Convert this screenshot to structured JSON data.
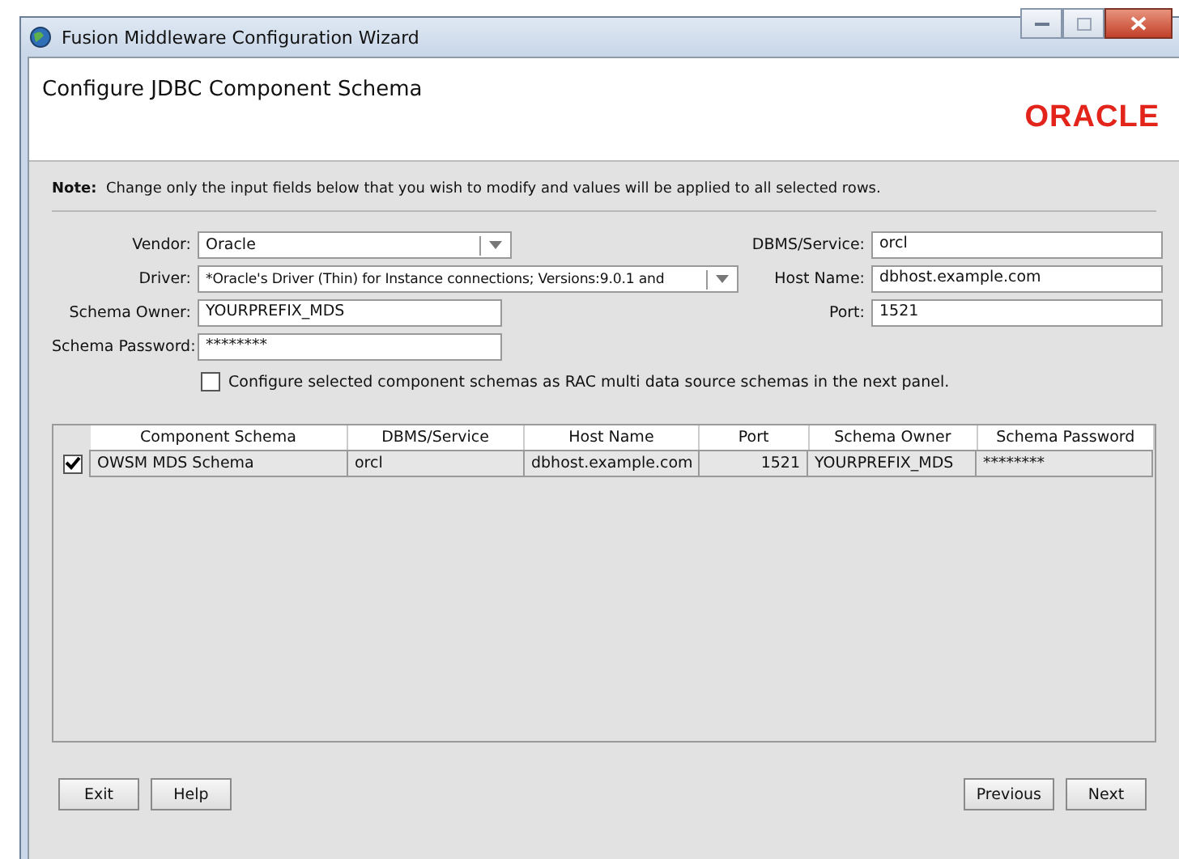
{
  "window": {
    "title": "Fusion Middleware Configuration Wizard"
  },
  "header": {
    "title": "Configure JDBC Component Schema",
    "logo": "ORACLE"
  },
  "note": {
    "label": "Note:",
    "text": "Change only the input fields below that you wish to modify and values will be applied to all selected rows."
  },
  "left_fields": [
    {
      "label": "Vendor:",
      "value": "Oracle",
      "kind": "combo"
    },
    {
      "label": "Driver:",
      "value": "*Oracle's  Driver (Thin) for Instance connections; Versions:9.0.1 and",
      "kind": "long_combo"
    },
    {
      "label": "Schema Owner:",
      "value": "YOURPREFIX_MDS",
      "kind": "text"
    },
    {
      "label": "Schema Password:",
      "value": "********",
      "kind": "text"
    }
  ],
  "right_fields": [
    {
      "label": "DBMS/Service:",
      "value": "orcl",
      "kind": "text"
    },
    {
      "label": "Host Name:",
      "value": "dbhost.example.com",
      "kind": "text"
    },
    {
      "label": "Port:",
      "value": "1521",
      "kind": "text"
    }
  ],
  "rac_option": {
    "label": "Configure selected component schemas as RAC multi data source schemas in the next panel.",
    "checked": false
  },
  "table": {
    "columns": [
      "Component Schema",
      "DBMS/Service",
      "Host Name",
      "Port",
      "Schema Owner",
      "Schema Password"
    ],
    "rows": [
      {
        "checked": true,
        "cells": [
          "OWSM MDS Schema",
          "orcl",
          "dbhost.example.com",
          "1521",
          "YOURPREFIX_MDS",
          "********"
        ]
      }
    ]
  },
  "buttons_left": [
    "Exit",
    "Help"
  ],
  "buttons_right": [
    "Previous",
    "Next"
  ]
}
